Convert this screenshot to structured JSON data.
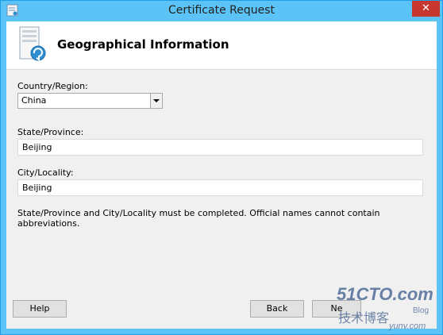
{
  "window": {
    "title": "Certificate Request",
    "close_label": "✕"
  },
  "header": {
    "title": "Geographical Information"
  },
  "form": {
    "country_label": "Country/Region:",
    "country_value": "China",
    "state_label": "State/Province:",
    "state_value": "Beijing",
    "city_label": "City/Locality:",
    "city_value": "Beijing",
    "note": "State/Province and City/Locality must be completed. Official names cannot contain abbreviations."
  },
  "buttons": {
    "help": "Help",
    "back": "Back",
    "next": "Ne"
  },
  "watermark": {
    "line1": "51CTO.com",
    "line2": "技术博客",
    "line3": "Blog",
    "line4": "yunv.com"
  }
}
